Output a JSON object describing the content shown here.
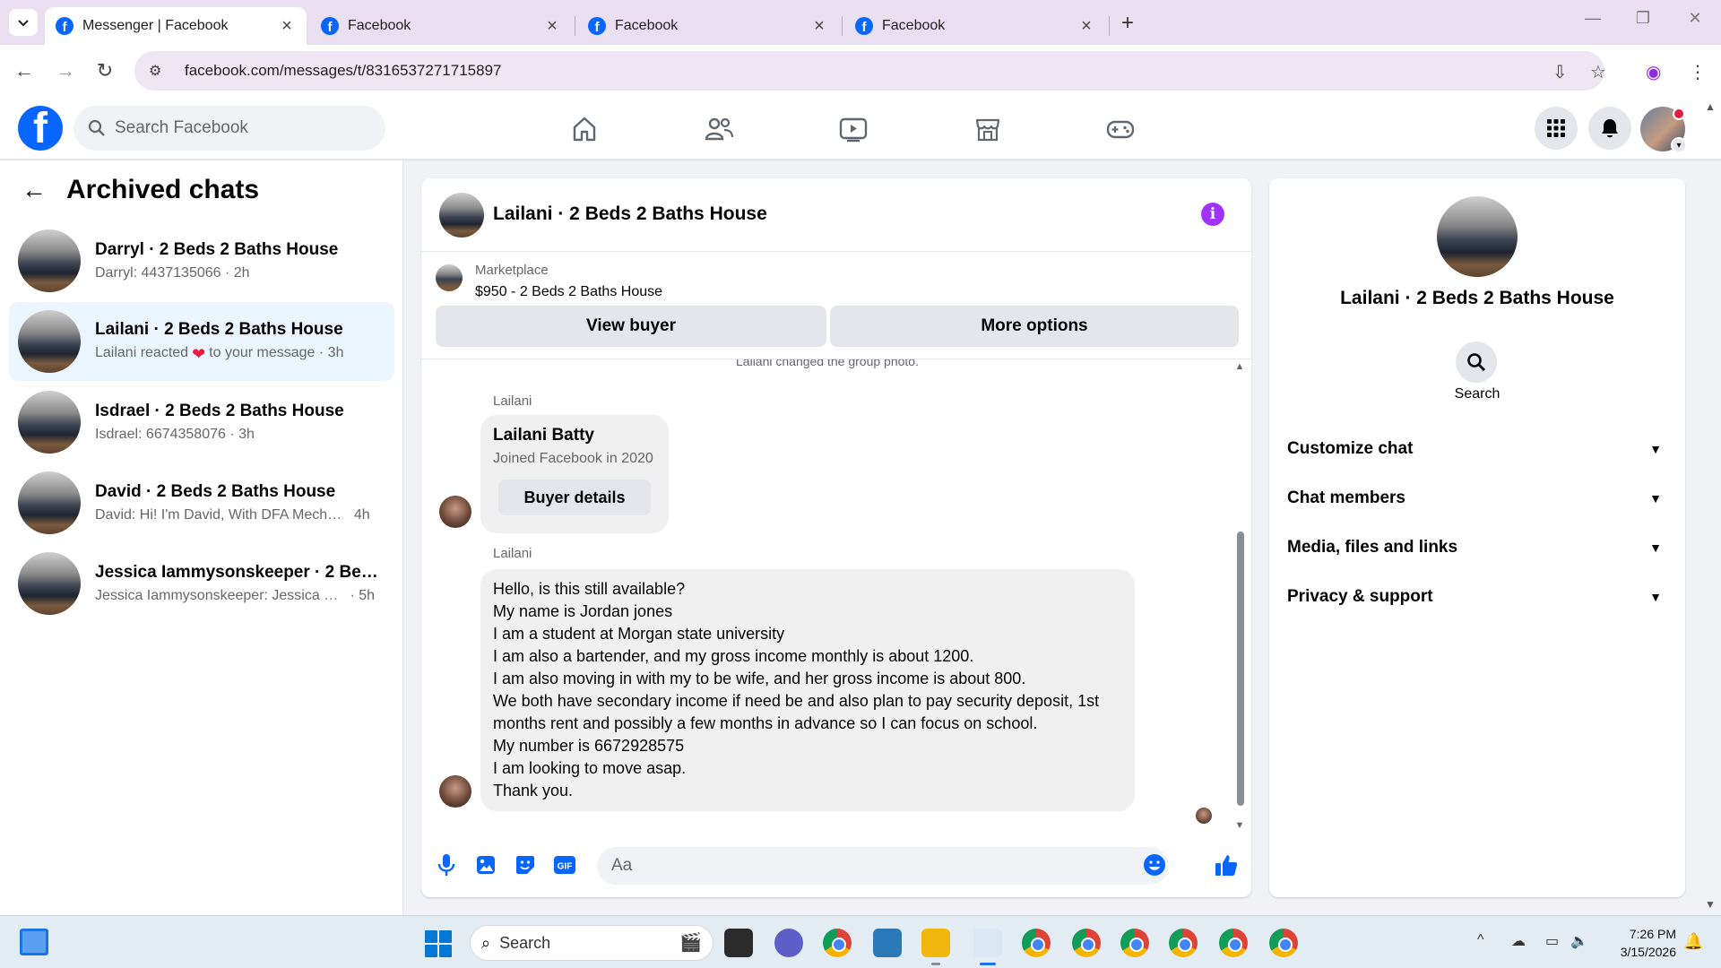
{
  "browser": {
    "tabs": [
      {
        "title": "Messenger | Facebook",
        "active": true
      },
      {
        "title": "Facebook",
        "active": false
      },
      {
        "title": "Facebook",
        "active": false
      },
      {
        "title": "Facebook",
        "active": false
      }
    ],
    "url": "facebook.com/messages/t/8316537271715897"
  },
  "fb_header": {
    "logo": "f",
    "search_placeholder": "Search Facebook",
    "nav_icons": [
      "home-icon",
      "friends-icon",
      "video-icon",
      "marketplace-icon",
      "gaming-icon"
    ],
    "right_icons": [
      "menu-grid-icon",
      "bell-icon",
      "profile-avatar"
    ]
  },
  "left_panel": {
    "title": "Archived chats",
    "chats": [
      {
        "name": "Darryl · 2 Beds 2 Baths House",
        "preview": "Darryl: 4437135066",
        "time": "2h",
        "selected": false
      },
      {
        "name": "Lailani · 2 Beds 2 Baths House",
        "preview_before": "Lailani reacted",
        "preview_after": "to your message",
        "time": "3h",
        "selected": true
      },
      {
        "name": "Isdrael · 2 Beds 2 Baths House",
        "preview": "Isdrael: 6674358076",
        "time": "3h",
        "selected": false
      },
      {
        "name": "David · 2 Beds 2 Baths House",
        "preview": "David: Hi! I'm David, With DFA Mecha...",
        "time": "4h",
        "selected": false
      },
      {
        "name": "Jessica Iammysonskeeper · 2 Beds ...",
        "preview": "Jessica Iammysonskeeper: Jessica Ma...",
        "time": "5h",
        "selected": false
      }
    ]
  },
  "conversation": {
    "title": "Lailani · 2 Beds 2 Baths House",
    "marketplace": {
      "label": "Marketplace",
      "listing": "$950 - 2 Beds 2 Baths House",
      "view_buyer": "View buyer",
      "more_options": "More options"
    },
    "system_note": "Lailani changed the group photo.",
    "card": {
      "sender": "Lailani",
      "name": "Lailani Batty",
      "subtitle": "Joined Facebook in 2020",
      "button": "Buyer details"
    },
    "message": {
      "sender": "Lailani",
      "lines": [
        "Hello, is this still available?",
        "My name is Jordan jones",
        "I am a student at Morgan state university",
        "I am also a bartender, and my gross income monthly is about 1200.",
        "I am also moving in with my to be wife, and her gross income is about 800.",
        "We both have secondary income if need be and also plan to pay security deposit, 1st months rent and possibly a few months in advance so I can focus on school.",
        "My number is 6672928575",
        "I am looking to move asap.",
        "Thank you."
      ]
    },
    "composer": {
      "placeholder": "Aa",
      "icons": [
        "microphone-icon",
        "photo-icon",
        "sticker-icon",
        "gif-icon",
        "emoji-icon",
        "thumbs-up-icon"
      ],
      "gif_label": "GIF"
    }
  },
  "right_panel": {
    "name": "Lailani · 2 Beds 2 Baths House",
    "search_label": "Search",
    "sections": [
      "Customize chat",
      "Chat members",
      "Media, files and links",
      "Privacy & support"
    ]
  },
  "taskbar": {
    "search_text": "Search",
    "time": "7:26 PM",
    "date": "3/15/2026"
  },
  "colors": {
    "fb_blue": "#0866ff",
    "selected_chat_bg": "#ebf5ff",
    "info_purple": "#a033ff",
    "bubble_gray": "#f0f0f0"
  }
}
